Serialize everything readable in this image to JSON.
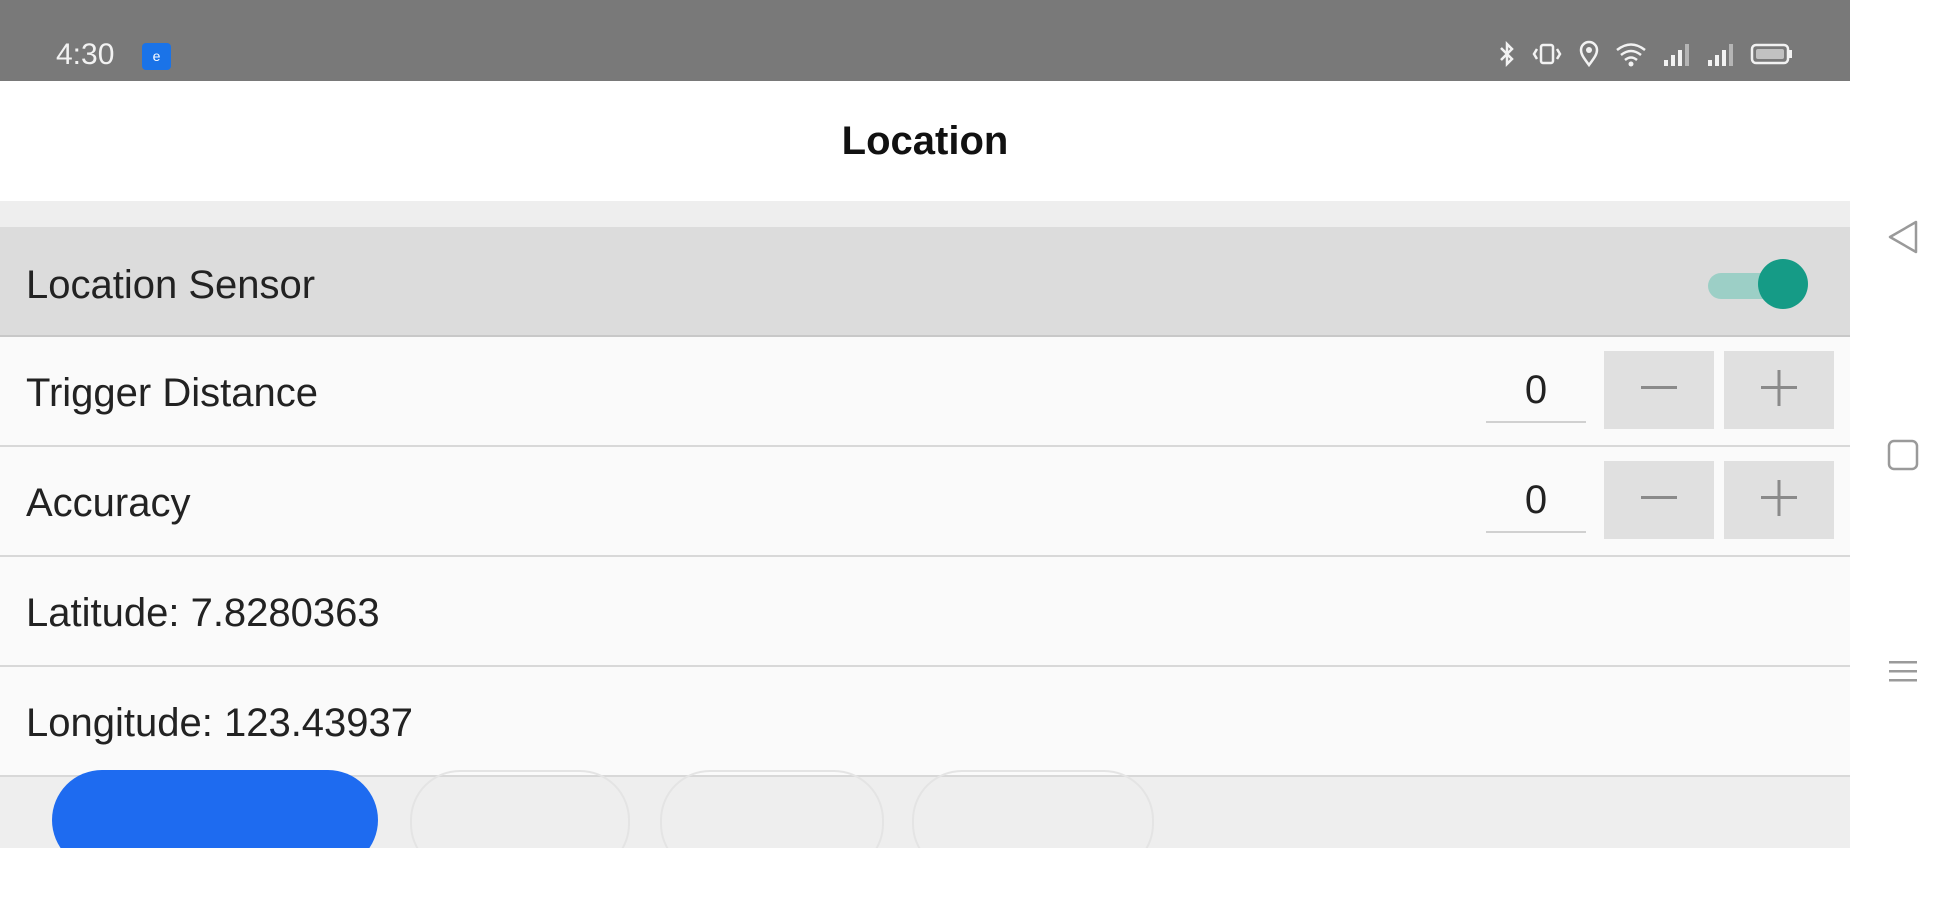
{
  "status_bar": {
    "time": "4:30",
    "notification_badge": "e",
    "icons": [
      "bluetooth-icon",
      "vibrate-icon",
      "location-icon",
      "wifi-icon",
      "signal-icon",
      "signal-icon",
      "battery-icon"
    ]
  },
  "header": {
    "title": "Location"
  },
  "settings": {
    "sensor": {
      "label": "Location Sensor",
      "enabled": true
    },
    "trigger_distance": {
      "label": "Trigger Distance",
      "value": "0"
    },
    "accuracy": {
      "label": "Accuracy",
      "value": "0"
    },
    "latitude": {
      "text": "Latitude: 7.8280363"
    },
    "longitude": {
      "text": "Longitude: 123.43937"
    }
  },
  "nav_bar": {
    "buttons": [
      "back-icon",
      "home-icon",
      "menu-icon"
    ]
  },
  "colors": {
    "accent": "#159b86",
    "accent_light": "#9ccfc6",
    "status_bar": "#797979",
    "primary_button": "#1e6bf0"
  }
}
